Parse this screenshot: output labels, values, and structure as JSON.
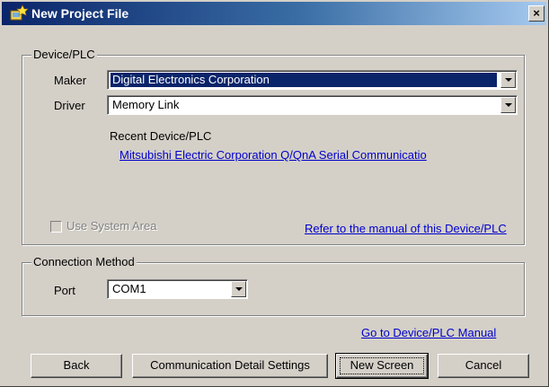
{
  "window": {
    "title": "New Project File",
    "close_label": "×"
  },
  "device_plc": {
    "group_label": "Device/PLC",
    "maker_label": "Maker",
    "maker_value": "Digital Electronics Corporation",
    "driver_label": "Driver",
    "driver_value": "Memory Link",
    "recent_label": "Recent Device/PLC",
    "recent_link": "Mitsubishi Electric Corporation Q/QnA Serial Communicatio",
    "use_system_area_label": "Use System Area",
    "use_system_area_checked": false,
    "manual_link": "Refer to the manual of this Device/PLC"
  },
  "connection": {
    "group_label": "Connection Method",
    "port_label": "Port",
    "port_value": "COM1"
  },
  "footer": {
    "manual_link": "Go to Device/PLC Manual",
    "back_label": "Back",
    "comm_settings_label": "Communication Detail Settings",
    "new_screen_label": "New Screen",
    "cancel_label": "Cancel"
  },
  "colors": {
    "title_start": "#0a246a",
    "title_end": "#a6caf0",
    "link": "#0000cc",
    "face": "#d4d0c8"
  }
}
